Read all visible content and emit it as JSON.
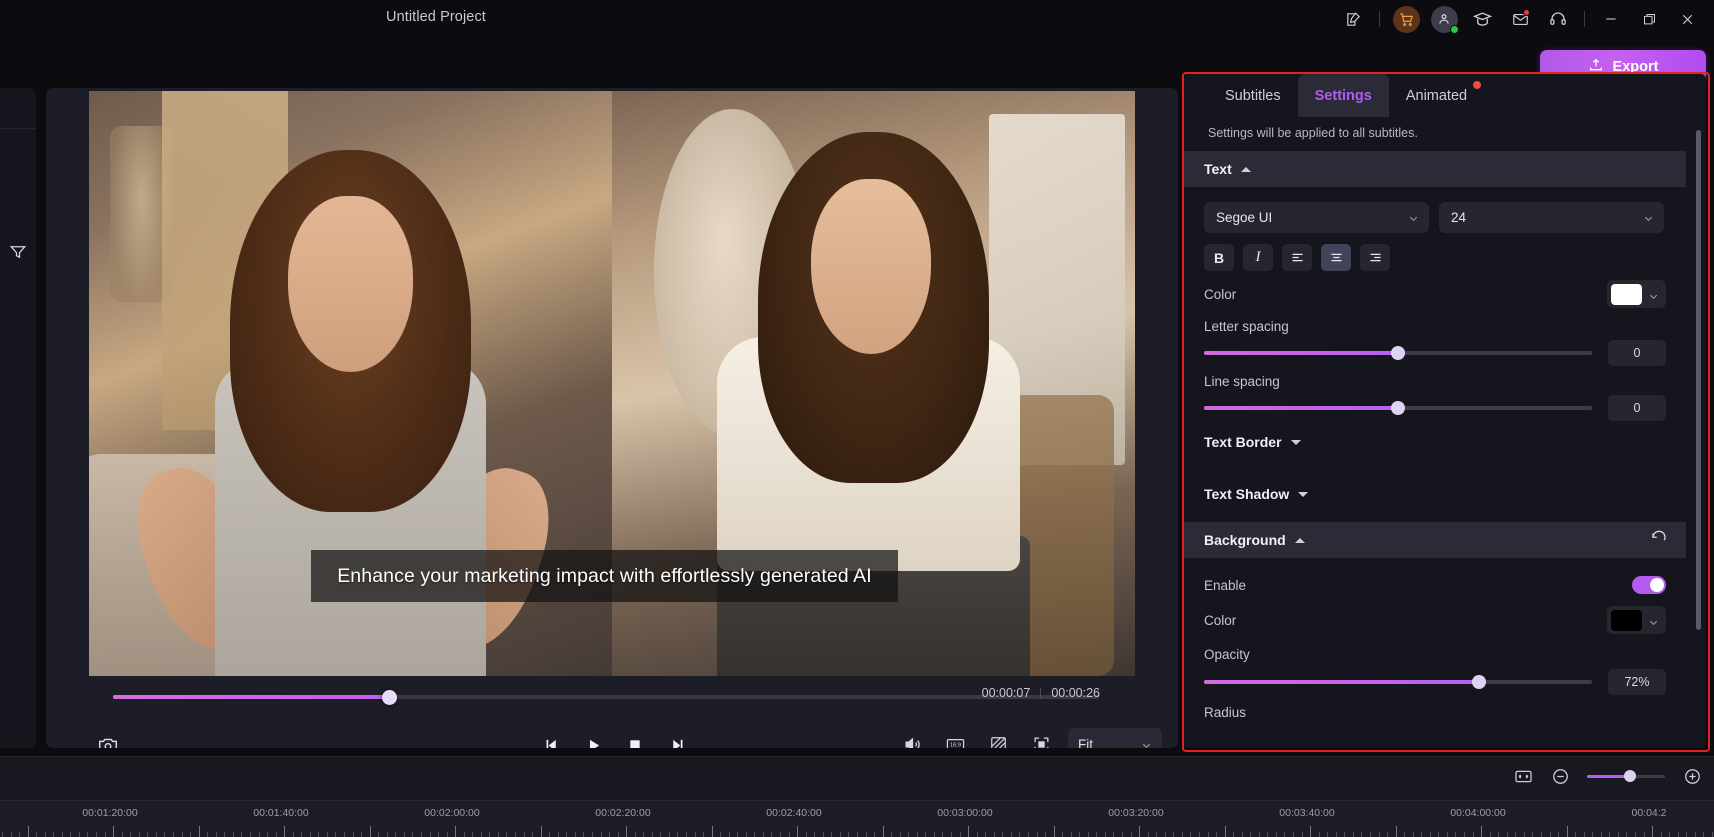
{
  "titlebar": {
    "project_title": "Untitled Project",
    "icons": [
      {
        "name": "note-edit-icon"
      },
      {
        "name": "shopping-cart-icon"
      },
      {
        "name": "user-avatar-icon"
      },
      {
        "name": "graduation-cap-icon"
      },
      {
        "name": "mail-icon"
      },
      {
        "name": "headset-support-icon"
      },
      {
        "name": "minimize-icon"
      },
      {
        "name": "maximize-restore-icon"
      },
      {
        "name": "close-icon"
      }
    ]
  },
  "export": {
    "label": "Export",
    "icon": "upload-icon",
    "accent": "#b94cf0"
  },
  "left_rail": {
    "filter_icon": "filter-funnel-icon"
  },
  "preview": {
    "subtitle_text": "Enhance your marketing impact with effortlessly generated AI",
    "current_time": "00:00:07",
    "total_time": "00:00:26",
    "progress_percent": 28,
    "snapshot_icon": "camera-icon",
    "transport": [
      {
        "name": "prev-frame-button",
        "icon": "step-backward-icon"
      },
      {
        "name": "play-button",
        "icon": "play-icon"
      },
      {
        "name": "stop-button",
        "icon": "stop-icon"
      },
      {
        "name": "next-frame-button",
        "icon": "step-forward-icon"
      }
    ],
    "tools": [
      {
        "name": "volume-button",
        "icon": "speaker-icon"
      },
      {
        "name": "aspect-ratio-button",
        "icon": "16-9-icon",
        "label": "16:9"
      },
      {
        "name": "mask-button",
        "icon": "diagonal-hatch-icon"
      },
      {
        "name": "fullscreen-button",
        "icon": "fullscreen-icon"
      }
    ],
    "fit_select": {
      "value": "Fit"
    }
  },
  "right_panel": {
    "tabs": [
      {
        "label": "Subtitles",
        "active": false,
        "dot": false
      },
      {
        "label": "Settings",
        "active": true,
        "dot": false
      },
      {
        "label": "Animated",
        "active": false,
        "dot": true
      }
    ],
    "note": "Settings will be applied to all subtitles.",
    "text_section": {
      "title": "Text",
      "expanded": true,
      "font_family": "Segoe UI",
      "font_size": "24",
      "format_buttons": [
        {
          "name": "bold-button",
          "label": "B",
          "active": false
        },
        {
          "name": "italic-button",
          "label": "I",
          "active": false
        },
        {
          "name": "align-left-button",
          "active": false
        },
        {
          "name": "align-center-button",
          "active": true
        },
        {
          "name": "align-right-button",
          "active": false
        }
      ],
      "color_label": "Color",
      "color_value": "#ffffff",
      "letter_spacing_label": "Letter spacing",
      "letter_spacing_value": "0",
      "letter_spacing_percent": 50,
      "line_spacing_label": "Line spacing",
      "line_spacing_value": "0",
      "line_spacing_percent": 50
    },
    "text_border_section": {
      "title": "Text Border",
      "expanded": false
    },
    "text_shadow_section": {
      "title": "Text Shadow",
      "expanded": false
    },
    "background_section": {
      "title": "Background",
      "expanded": true,
      "reset_icon": "reset-arrow-icon",
      "enable_label": "Enable",
      "enable_on": true,
      "color_label": "Color",
      "color_value": "#000000",
      "opacity_label": "Opacity",
      "opacity_value": "72%",
      "opacity_percent": 71,
      "radius_label": "Radius"
    }
  },
  "timeline": {
    "fit_icon": "fit-width-icon",
    "zoom_out_icon": "zoom-out-icon",
    "zoom_in_icon": "zoom-in-icon",
    "zoom_percent": 55,
    "ruler_labels": [
      "00:01:20:00",
      "00:01:40:00",
      "00:02:00:00",
      "00:02:20:00",
      "00:02:40:00",
      "00:03:00:00",
      "00:03:20:00",
      "00:03:40:00",
      "00:04:00:00",
      "00:04:2"
    ]
  }
}
